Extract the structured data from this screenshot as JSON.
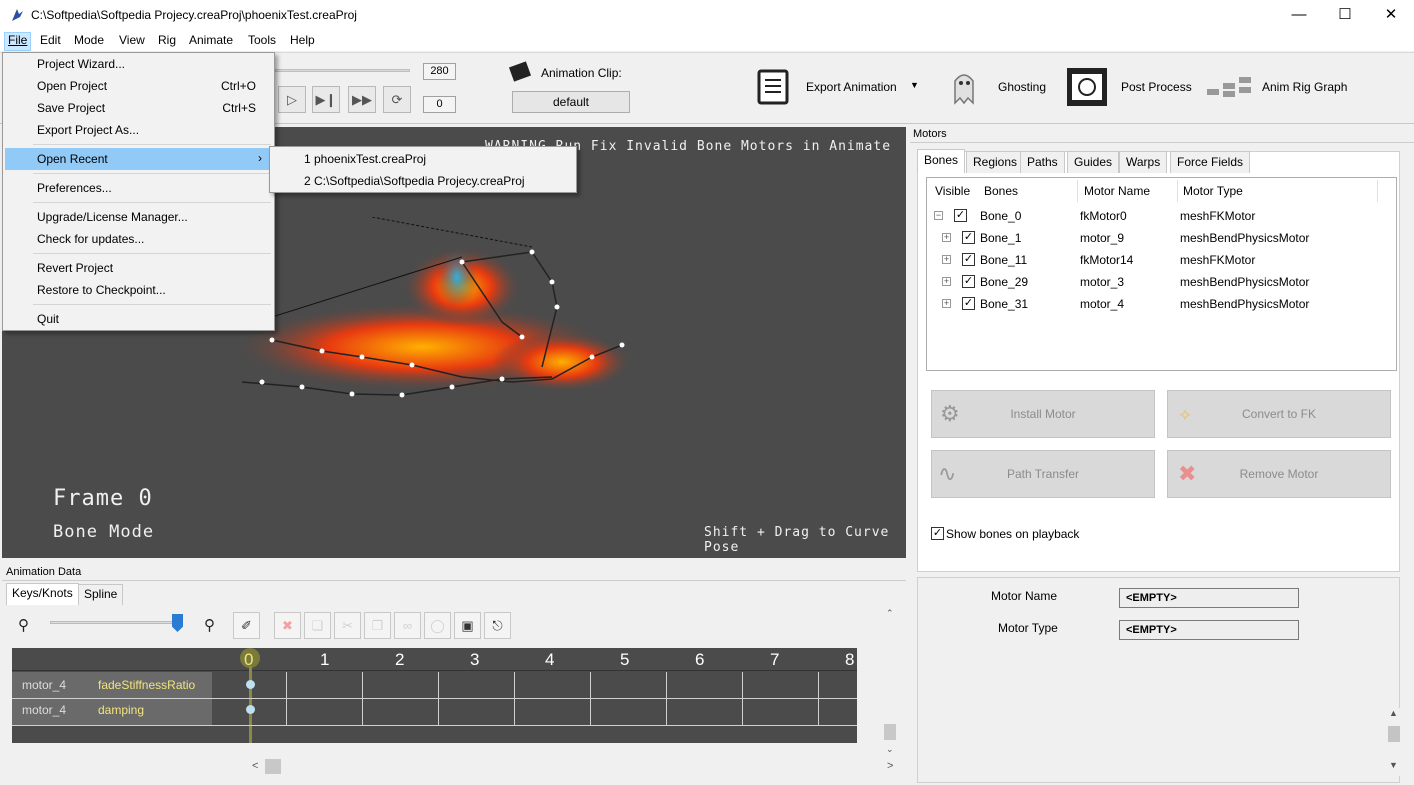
{
  "window": {
    "title": "C:\\Softpedia\\Softpedia Projecy.creaProj\\phoenixTest.creaProj"
  },
  "menubar": {
    "items": [
      "File",
      "Edit",
      "Mode",
      "View",
      "Rig",
      "Animate",
      "Tools",
      "Help"
    ]
  },
  "toolbar": {
    "end_frame": "280",
    "current_frame": "0",
    "animation_clip_label": "Animation Clip:",
    "animation_clip_value": "default",
    "export_label": "Export Animation",
    "ghosting_label": "Ghosting",
    "post_process_label": "Post Process",
    "anim_rig_graph_label": "Anim Rig Graph"
  },
  "viewport": {
    "warning": "WARNING Run Fix Invalid Bone Motors in Animate Menu",
    "frame": "Frame 0",
    "mode": "Bone Mode",
    "hint": "Shift + Drag to Curve Pose"
  },
  "file_menu": {
    "items": [
      {
        "label": "Project Wizard...",
        "shortcut": ""
      },
      {
        "label": "Open Project",
        "shortcut": "Ctrl+O"
      },
      {
        "label": "Save Project",
        "shortcut": "Ctrl+S"
      },
      {
        "label": "Export Project As...",
        "shortcut": ""
      },
      {
        "label": "Open Recent",
        "shortcut": ""
      },
      {
        "label": "Preferences...",
        "shortcut": ""
      },
      {
        "label": "Upgrade/License Manager...",
        "shortcut": ""
      },
      {
        "label": "Check for updates...",
        "shortcut": ""
      },
      {
        "label": "Revert Project",
        "shortcut": ""
      },
      {
        "label": "Restore to Checkpoint...",
        "shortcut": ""
      },
      {
        "label": "Quit",
        "shortcut": ""
      }
    ],
    "recent": [
      "1 phoenixTest.creaProj",
      "2 C:\\Softpedia\\Softpedia Projecy.creaProj"
    ]
  },
  "motors": {
    "panel_title": "Motors",
    "tabs": [
      "Bones",
      "Regions",
      "Paths",
      "Guides",
      "Warps",
      "Force Fields"
    ],
    "columns": [
      "Visible",
      "Bones",
      "Motor Name",
      "Motor Type"
    ],
    "rows": [
      {
        "bone": "Bone_0",
        "motor": "fkMotor0",
        "type": "meshFKMotor"
      },
      {
        "bone": "Bone_1",
        "motor": "motor_9",
        "type": "meshBendPhysicsMotor"
      },
      {
        "bone": "Bone_11",
        "motor": "fkMotor14",
        "type": "meshFKMotor"
      },
      {
        "bone": "Bone_29",
        "motor": "motor_3",
        "type": "meshBendPhysicsMotor"
      },
      {
        "bone": "Bone_31",
        "motor": "motor_4",
        "type": "meshBendPhysicsMotor"
      }
    ],
    "buttons": {
      "install": "Install Motor",
      "convert": "Convert to FK",
      "path_transfer": "Path Transfer",
      "remove": "Remove Motor"
    },
    "show_bones": "Show bones on playback",
    "motor_name_label": "Motor Name",
    "motor_name_value": "<EMPTY>",
    "motor_type_label": "Motor Type",
    "motor_type_value": "<EMPTY>"
  },
  "anim_data": {
    "panel_title": "Animation Data",
    "tabs": [
      "Keys/Knots",
      "Spline"
    ],
    "ticks": [
      "0",
      "1",
      "2",
      "3",
      "4",
      "5",
      "6",
      "7",
      "8"
    ],
    "tracks": [
      {
        "motor": "motor_4",
        "param": "fadeStiffnessRatio"
      },
      {
        "motor": "motor_4",
        "param": "damping"
      }
    ]
  },
  "colors": {
    "accent_yellow": "#f2e47a",
    "viewport_bg": "#4b4b4b",
    "blue_handle": "#2a7bd4"
  }
}
